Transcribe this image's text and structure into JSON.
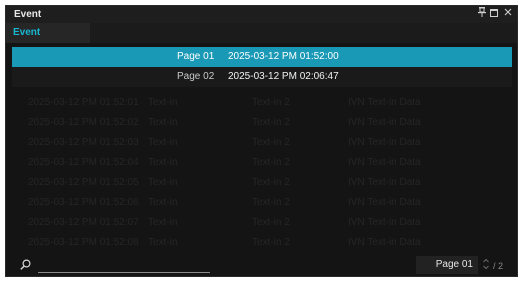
{
  "window": {
    "title": "Event"
  },
  "tabs": [
    {
      "label": "Event"
    }
  ],
  "dropdown": {
    "selected": {
      "page": "Page 01",
      "timestamp": "2025-03-12 PM 01:52:00"
    },
    "options": [
      {
        "page": "Page 02",
        "timestamp": "2025-03-12 PM 02:06:47"
      }
    ]
  },
  "table": {
    "rows": [
      [
        "2025-03-12 PM 01:52:00",
        "Text-in",
        "Text-in 2",
        "IVN Text-in Data"
      ],
      [
        "2025-03-12 PM 01:52:01",
        "Text-in",
        "Text-in 2",
        "IVN Text-in Data"
      ],
      [
        "2025-03-12 PM 01:52:02",
        "Text-in",
        "Text-in 2",
        "IVN Text-in Data"
      ],
      [
        "2025-03-12 PM 01:52:03",
        "Text-in",
        "Text-in 2",
        "IVN Text-in Data"
      ],
      [
        "2025-03-12 PM 01:52:04",
        "Text-in",
        "Text-in 2",
        "IVN Text-in Data"
      ],
      [
        "2025-03-12 PM 01:52:05",
        "Text-in",
        "Text-in 2",
        "IVN Text-in Data"
      ],
      [
        "2025-03-12 PM 01:52:06",
        "Text-in",
        "Text-in 2",
        "IVN Text-in Data"
      ],
      [
        "2025-03-12 PM 01:52:07",
        "Text-in",
        "Text-in 2",
        "IVN Text-in Data"
      ],
      [
        "2025-03-12 PM 01:52:08",
        "Text-in",
        "Text-in 2",
        "IVN Text-in Data"
      ]
    ]
  },
  "footer": {
    "search_placeholder": "",
    "page_value": "Page 01",
    "page_total": "/ 2"
  },
  "colors": {
    "accent": "#1a99b6",
    "tab_text": "#19b6d0",
    "background": "#141414"
  },
  "icons": {
    "search": "search-icon",
    "pin": "pin-icon",
    "maximize": "maximize-icon",
    "close": "close-icon",
    "stepper": "stepper-icon"
  }
}
